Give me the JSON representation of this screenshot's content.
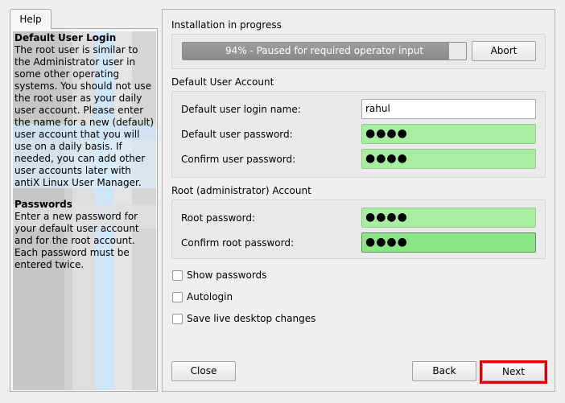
{
  "help": {
    "tab_label": "Help",
    "sections": [
      {
        "heading": "Default User Login",
        "body": "The root user is similar to the Administrator user in some other operating systems. You should not use the root user as your daily user account. Please enter the name for a new (default) user account that you will use on a daily basis. If needed, you can add other user accounts later with antiX Linux User Manager."
      },
      {
        "heading": "Passwords",
        "body": "Enter a new password for your default user account and for the root account. Each password must be entered twice."
      }
    ]
  },
  "installation": {
    "title": "Installation in progress",
    "progress_percent": 94,
    "progress_text": "94% - Paused for required operator input",
    "abort_label": "Abort"
  },
  "default_user": {
    "title": "Default User Account",
    "login_label": "Default user login name:",
    "login_value": "rahul",
    "password_label": "Default user password:",
    "password_value": "●●●●",
    "confirm_label": "Confirm user password:",
    "confirm_value": "●●●●"
  },
  "root_account": {
    "title": "Root (administrator) Account",
    "password_label": "Root password:",
    "password_value": "●●●●",
    "confirm_label": "Confirm root password:",
    "confirm_value": "●●●●"
  },
  "options": {
    "show_passwords": "Show passwords",
    "autologin": "Autologin",
    "save_live": "Save live desktop changes"
  },
  "footer": {
    "close_label": "Close",
    "back_label": "Back",
    "next_label": "Next"
  },
  "colors": {
    "password_ok": "#a8eea0",
    "highlight": "#e00000"
  }
}
